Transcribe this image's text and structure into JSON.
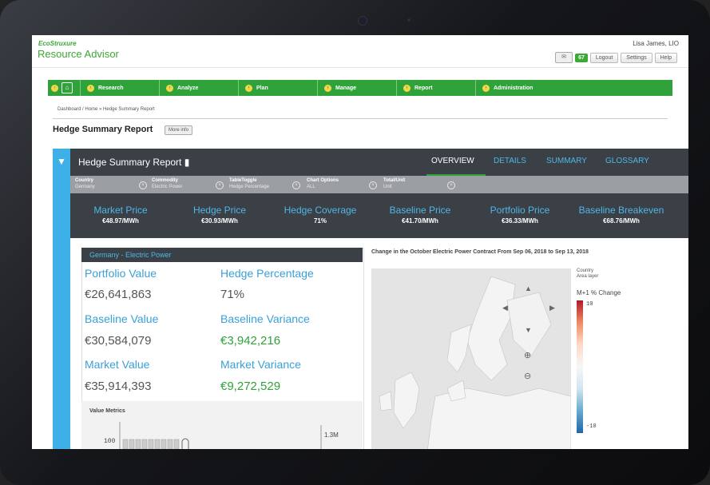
{
  "app": {
    "logo_top": "EcoStruxure",
    "logo_main": "Resource Advisor",
    "user": "Lisa James, LIO",
    "mail_count": "67",
    "buttons": [
      "Logout",
      "Settings",
      "Help"
    ]
  },
  "nav": {
    "items": [
      "Research",
      "Analyze",
      "Plan",
      "Manage",
      "Report",
      "Administration"
    ]
  },
  "breadcrumb": "Dashboard / Home »  Hedge Summary Report",
  "page": {
    "title": "Hedge Summary Report",
    "more_info": "More info"
  },
  "report": {
    "title": "Hedge Summary Report",
    "tabs": [
      "OVERVIEW",
      "DETAILS",
      "SUMMARY",
      "GLOSSARY"
    ],
    "active_tab": "OVERVIEW",
    "filters": [
      {
        "label": "Country",
        "value": "Germany"
      },
      {
        "label": "Commodity",
        "value": "Electric Power"
      },
      {
        "label": "TableToggle",
        "value": "Hedge Percentage"
      },
      {
        "label": "Chart Options",
        "value": "ALL"
      },
      {
        "label": "Total/Unit",
        "value": "Unit"
      }
    ],
    "kpis": [
      {
        "label": "Market Price",
        "value": "€48.97/MWh"
      },
      {
        "label": "Hedge Price",
        "value": "€30.93/MWh"
      },
      {
        "label": "Hedge Coverage",
        "value": "71%"
      },
      {
        "label": "Baseline Price",
        "value": "€41.70/MWh"
      },
      {
        "label": "Portfolio Price",
        "value": "€36.33/MWh"
      },
      {
        "label": "Baseline Breakeven",
        "value": "€68.76/MWh"
      }
    ]
  },
  "card": {
    "title": "Germany - Electric Power",
    "metrics": [
      {
        "label": "Portfolio Value",
        "value": "€26,641,863"
      },
      {
        "label": "Hedge Percentage",
        "value": "71%"
      },
      {
        "label": "Baseline Value",
        "value": "€30,584,079"
      },
      {
        "label": "Baseline Variance",
        "value": "€3,942,216"
      },
      {
        "label": "Market Value",
        "value": "€35,914,393"
      },
      {
        "label": "Market Variance",
        "value": "€9,272,529"
      }
    ],
    "value_metrics": {
      "title": "Value Metrics",
      "y_tick": "100",
      "right_label": "1.3M"
    }
  },
  "map": {
    "title": "Change in the October Electric Power Contract From Sep 06, 2018 to Sep 13, 2018",
    "legend": {
      "layer_title": "Country",
      "layer_sub": "Area layer",
      "scale_title": "M+1 % Change",
      "max": "10",
      "min": "-10"
    }
  },
  "colors": {
    "brand_green": "#2fa33a",
    "accent_blue": "#3db0e8",
    "dark_panel": "#3b4047"
  }
}
